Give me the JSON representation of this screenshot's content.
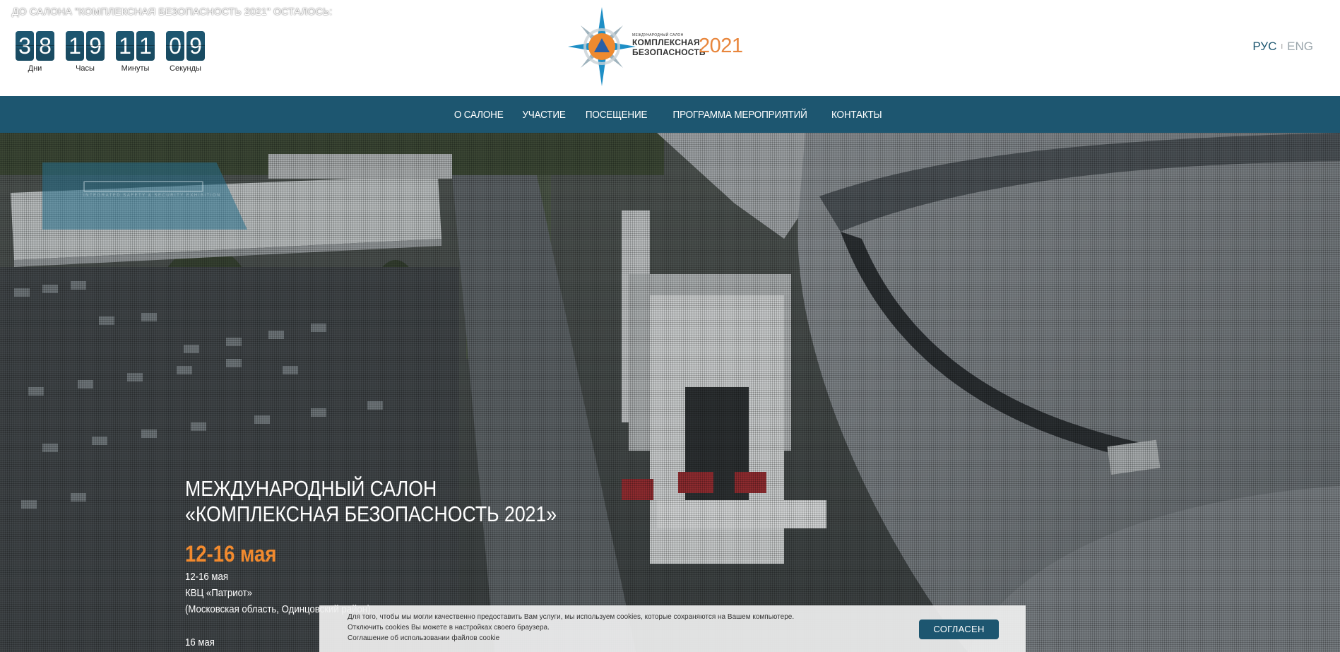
{
  "countdown": {
    "title": "ДО САЛОНА \"КОМПЛЕКСНАЯ БЕЗОПАСНОСТЬ 2021\" ОСТАЛОСЬ:",
    "groups": [
      {
        "digits": [
          "3",
          "8"
        ],
        "label": "Дни"
      },
      {
        "digits": [
          "1",
          "9"
        ],
        "label": "Часы"
      },
      {
        "digits": [
          "1",
          "1"
        ],
        "label": "Минуты"
      },
      {
        "digits": [
          "0",
          "9"
        ],
        "label": "Секунды"
      }
    ],
    "digit_color": "#1d5670"
  },
  "logo": {
    "small_text": "МЕЖДУНАРОДНЫЙ САЛОН",
    "line1": "КОМПЛЕКСНАЯ",
    "line2": "БЕЗОПАСНОСТЬ",
    "year": "2021"
  },
  "language": {
    "active": "РУС",
    "separator": "I",
    "other": "ENG"
  },
  "nav": {
    "items": [
      "О САЛОНЕ",
      "УЧАСТИЕ",
      "ПОСЕЩЕНИЕ",
      "ПРОГРАММА МЕРОПРИЯТИЙ",
      "КОНТАКТЫ"
    ],
    "background": "#1d5670"
  },
  "hero": {
    "badge_text": "INTEGRATED SAFETY & SECURITY EXHIBITION",
    "title_line1": "МЕЖДУНАРОДНЫЙ САЛОН",
    "title_line2": "«КОМПЛЕКСНАЯ БЕЗОПАСНОСТЬ 2021»",
    "dates": "12-16 мая",
    "details": [
      "12-16 мая",
      "КВЦ «Патриот»",
      "(Московская область, Одинцовский район)",
      "",
      "16 мая"
    ],
    "accent": "#f28a2e"
  },
  "cookie": {
    "text_line1": "Для того, чтобы мы могли качественно предоставить Вам услуги, мы используем cookies, которые сохраняются на Вашем компьютере.",
    "text_line2": "Отключить cookies Вы можете в настройках своего браузера.",
    "text_line3": "Соглашение об использовании файлов cookie",
    "button": "СОГЛАСЕН"
  }
}
